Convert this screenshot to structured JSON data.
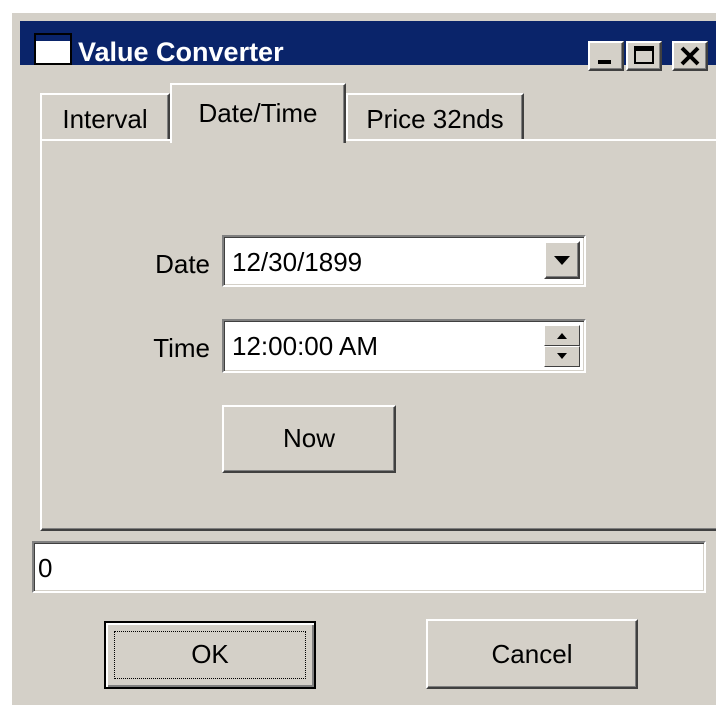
{
  "window": {
    "title": "Value Converter",
    "controls": {
      "minimize_icon": "minimize-icon",
      "maximize_icon": "maximize-icon",
      "close_icon": "close-icon"
    }
  },
  "tabs": [
    {
      "label": "Interval",
      "selected": false
    },
    {
      "label": "Date/Time",
      "selected": true
    },
    {
      "label": "Price 32nds",
      "selected": false
    }
  ],
  "datetime": {
    "date_label": "Date",
    "date_value": "12/30/1899",
    "time_label": "Time",
    "time_value": "12:00:00 AM",
    "now_button": "Now"
  },
  "result": {
    "value": "0"
  },
  "buttons": {
    "ok": "OK",
    "cancel": "Cancel"
  },
  "colors": {
    "face": "#d4d0c8",
    "titlebar": "#0a246a",
    "title_text": "#ffffff",
    "shadow": "#808080",
    "highlight": "#ffffff"
  }
}
